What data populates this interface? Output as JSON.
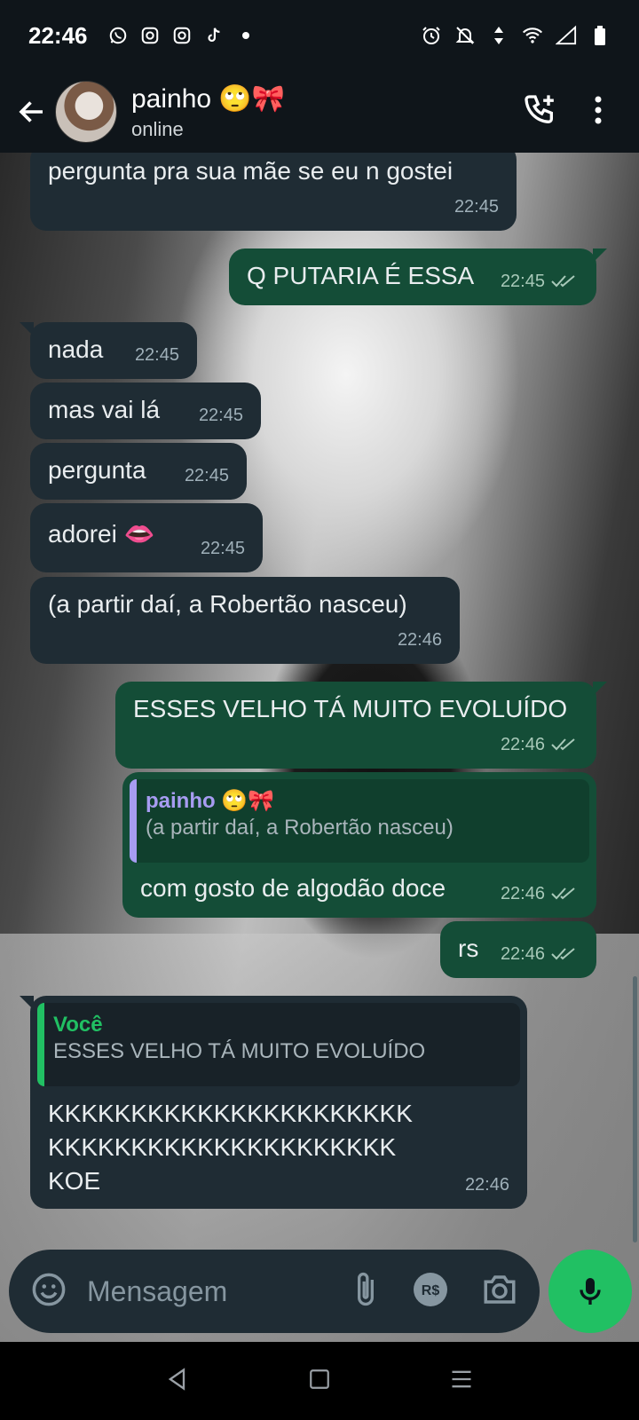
{
  "status_bar": {
    "time": "22:46",
    "notification_icons": [
      "whatsapp-icon",
      "instagram-icon",
      "instagram-icon",
      "tiktok-icon",
      "dot-icon"
    ],
    "system_icons": [
      "alarm-icon",
      "bell-off-icon",
      "data-arrows-icon",
      "wifi-icon",
      "signal-icon",
      "battery-icon"
    ]
  },
  "header": {
    "contact_name": "painho 🙄🎀",
    "contact_status": "online"
  },
  "messages": [
    {
      "dir": "in",
      "text": "pergunta pra sua mãe se eu n gostei",
      "time": "22:45"
    },
    {
      "dir": "out",
      "text": "Q PUTARIA É ESSA",
      "time": "22:45",
      "read": true
    },
    {
      "dir": "in",
      "text": "nada",
      "time": "22:45"
    },
    {
      "dir": "in",
      "text": "mas vai lá",
      "time": "22:45"
    },
    {
      "dir": "in",
      "text": "pergunta",
      "time": "22:45"
    },
    {
      "dir": "in",
      "text": "adorei 👄",
      "time": "22:45"
    },
    {
      "dir": "in",
      "text": "(a partir daí, a Robertão nasceu)",
      "time": "22:46"
    },
    {
      "dir": "out",
      "text": "ESSES VELHO TÁ MUITO EVOLUÍDO",
      "time": "22:46",
      "read": true
    },
    {
      "dir": "out",
      "reply_to": {
        "name": "painho 🙄🎀",
        "text": "(a partir daí, a Robertão nasceu)"
      },
      "text": "com gosto de algodão doce",
      "time": "22:46",
      "read": true
    },
    {
      "dir": "out",
      "text": "rs",
      "time": "22:46",
      "read": true
    },
    {
      "dir": "in",
      "reply_to": {
        "name": "Você",
        "text": "ESSES VELHO TÁ MUITO EVOLUÍDO"
      },
      "lines": [
        "KKKKKKKKKKKKKKKKKKKKKK",
        "KKKKKKKKKKKKKKKKKKKKK",
        "KOE"
      ],
      "time": "22:46"
    }
  ],
  "input": {
    "placeholder": "Mensagem"
  },
  "colors": {
    "incoming_bubble": "#1f2c34",
    "outgoing_bubble": "#144d37",
    "accent_green": "#21c063",
    "quote_purple": "#a79cf2"
  }
}
